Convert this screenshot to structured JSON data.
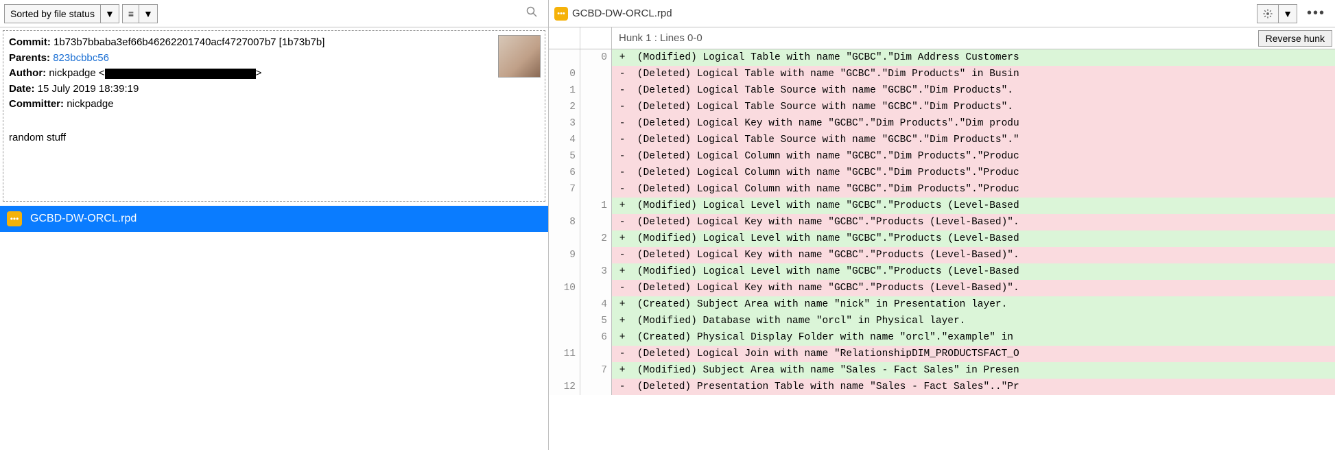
{
  "left": {
    "sort_label": "Sorted by file status",
    "commit": {
      "labels": {
        "commit": "Commit:",
        "parents": "Parents:",
        "author": "Author:",
        "date": "Date:",
        "committer": "Committer:"
      },
      "hash_full": "1b73b7bbaba3ef66b46262201740acf4727007b7",
      "hash_short": "[1b73b7b]",
      "parent_short": "823bcbbc56",
      "author_name": "nickpadge",
      "date": "15 July 2019 18:39:19",
      "committer": "nickpadge",
      "message": "random stuff"
    },
    "file": "GCBD-DW-ORCL.rpd"
  },
  "right": {
    "filename": "GCBD-DW-ORCL.rpd",
    "hunk_label": "Hunk 1 : Lines 0-0",
    "reverse_label": "Reverse hunk",
    "lines": [
      {
        "old": "",
        "new": "0",
        "kind": "add",
        "text": " +  (Modified) Logical Table with name \"GCBC\".\"Dim Address Customers"
      },
      {
        "old": "0",
        "new": "",
        "kind": "del",
        "text": " -  (Deleted) Logical Table with name \"GCBC\".\"Dim Products\" in Busin"
      },
      {
        "old": "1",
        "new": "",
        "kind": "del",
        "text": " -  (Deleted) Logical Table Source with name \"GCBC\".\"Dim Products\"."
      },
      {
        "old": "2",
        "new": "",
        "kind": "del",
        "text": " -  (Deleted) Logical Table Source with name \"GCBC\".\"Dim Products\"."
      },
      {
        "old": "3",
        "new": "",
        "kind": "del",
        "text": " -  (Deleted) Logical Key with name \"GCBC\".\"Dim Products\".\"Dim produ"
      },
      {
        "old": "4",
        "new": "",
        "kind": "del",
        "text": " -  (Deleted) Logical Table Source with name \"GCBC\".\"Dim Products\".\""
      },
      {
        "old": "5",
        "new": "",
        "kind": "del",
        "text": " -  (Deleted) Logical Column with name \"GCBC\".\"Dim Products\".\"Produc"
      },
      {
        "old": "6",
        "new": "",
        "kind": "del",
        "text": " -  (Deleted) Logical Column with name \"GCBC\".\"Dim Products\".\"Produc"
      },
      {
        "old": "7",
        "new": "",
        "kind": "del",
        "text": " -  (Deleted) Logical Column with name \"GCBC\".\"Dim Products\".\"Produc"
      },
      {
        "old": "",
        "new": "1",
        "kind": "add",
        "text": " +  (Modified) Logical Level with name \"GCBC\".\"Products (Level-Based"
      },
      {
        "old": "8",
        "new": "",
        "kind": "del",
        "text": " -  (Deleted) Logical Key with name \"GCBC\".\"Products (Level-Based)\"."
      },
      {
        "old": "",
        "new": "2",
        "kind": "add",
        "text": " +  (Modified) Logical Level with name \"GCBC\".\"Products (Level-Based"
      },
      {
        "old": "9",
        "new": "",
        "kind": "del",
        "text": " -  (Deleted) Logical Key with name \"GCBC\".\"Products (Level-Based)\"."
      },
      {
        "old": "",
        "new": "3",
        "kind": "add",
        "text": " +  (Modified) Logical Level with name \"GCBC\".\"Products (Level-Based"
      },
      {
        "old": "10",
        "new": "",
        "kind": "del",
        "text": " -  (Deleted) Logical Key with name \"GCBC\".\"Products (Level-Based)\"."
      },
      {
        "old": "",
        "new": "4",
        "kind": "add",
        "text": " +  (Created) Subject Area with name \"nick\" in Presentation layer."
      },
      {
        "old": "",
        "new": "5",
        "kind": "add",
        "text": " +  (Modified) Database with name \"orcl\" in Physical layer."
      },
      {
        "old": "",
        "new": "6",
        "kind": "add",
        "text": " +  (Created) Physical Display Folder with name \"orcl\".\"example\" in "
      },
      {
        "old": "11",
        "new": "",
        "kind": "del",
        "text": " -  (Deleted) Logical Join with name \"RelationshipDIM_PRODUCTSFACT_O"
      },
      {
        "old": "",
        "new": "7",
        "kind": "add",
        "text": " +  (Modified) Subject Area with name \"Sales - Fact Sales\" in Presen"
      },
      {
        "old": "12",
        "new": "",
        "kind": "del",
        "text": " -  (Deleted) Presentation Table with name \"Sales - Fact Sales\"..\"Pr"
      }
    ]
  }
}
